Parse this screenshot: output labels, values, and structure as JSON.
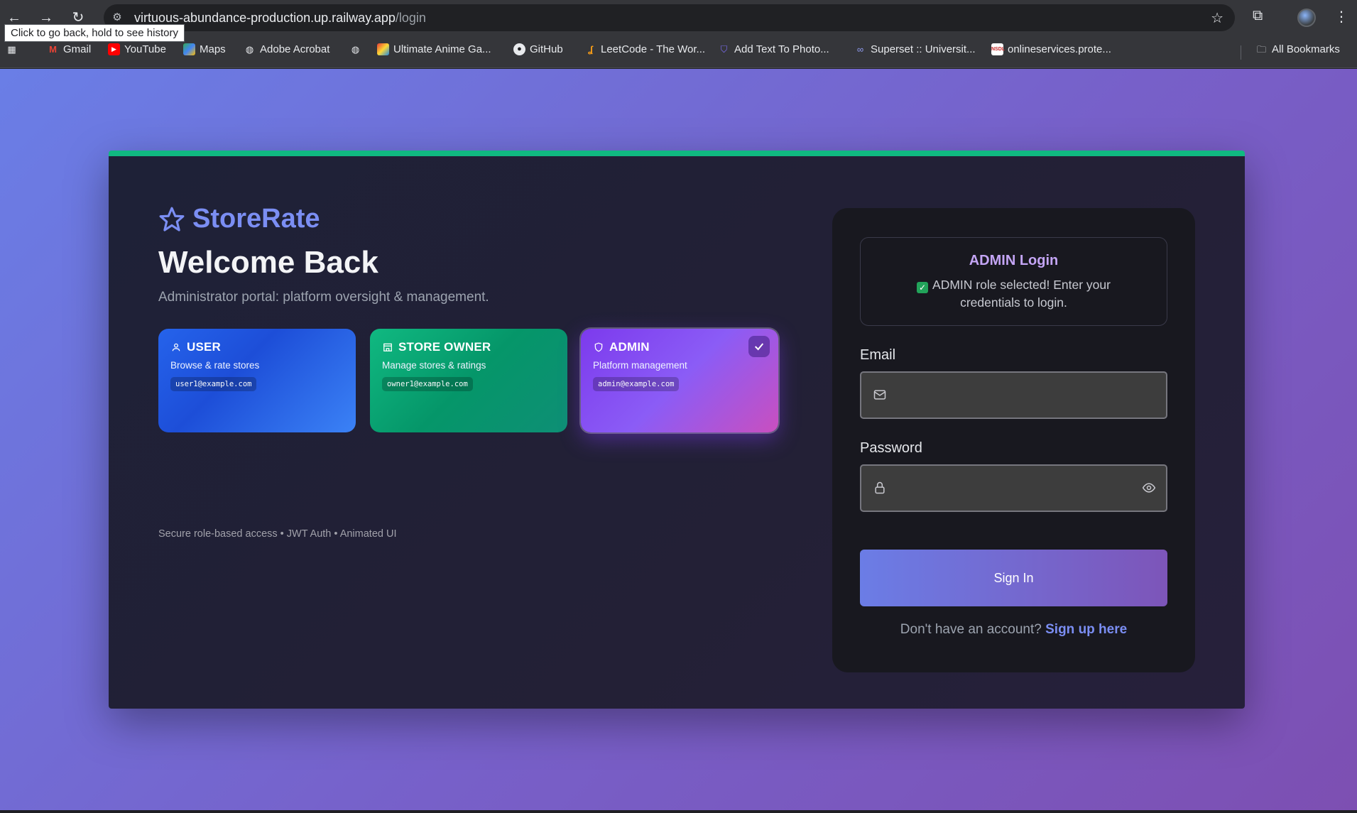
{
  "browser": {
    "url_host": "virtuous-abundance-production.up.railway.app",
    "url_path": "/login",
    "back_tooltip": "Click to go back, hold to see history",
    "bookmarks": [
      {
        "label": "Gmail",
        "icon": "gmail-icon"
      },
      {
        "label": "YouTube",
        "icon": "youtube-icon"
      },
      {
        "label": "Maps",
        "icon": "maps-icon"
      },
      {
        "label": "Adobe Acrobat",
        "icon": "globe-icon"
      },
      {
        "label": "",
        "icon": "globe-icon"
      },
      {
        "label": "Ultimate Anime Ga...",
        "icon": "anime-icon"
      },
      {
        "label": "GitHub",
        "icon": "github-icon"
      },
      {
        "label": "LeetCode - The Wor...",
        "icon": "leetcode-icon"
      },
      {
        "label": "Add Text To Photo...",
        "icon": "shield-icon"
      },
      {
        "label": "Superset :: Universit...",
        "icon": "superset-icon"
      },
      {
        "label": "onlineservices.prote...",
        "icon": "nsdl-icon"
      }
    ],
    "all_bookmarks": "All Bookmarks"
  },
  "brand": {
    "name": "StoreRate"
  },
  "hero": {
    "title": "Welcome Back",
    "subtitle": "Administrator portal: platform oversight & management."
  },
  "roles": [
    {
      "title": "USER",
      "desc": "Browse & rate stores",
      "email": "user1@example.com",
      "selected": false
    },
    {
      "title": "STORE OWNER",
      "desc": "Manage stores & ratings",
      "email": "owner1@example.com",
      "selected": false
    },
    {
      "title": "ADMIN",
      "desc": "Platform management",
      "email": "admin@example.com",
      "selected": true
    }
  ],
  "footnote": "Secure role-based access • JWT Auth • Animated UI",
  "login": {
    "title": "ADMIN Login",
    "message": "ADMIN role selected! Enter your credentials to login.",
    "email_label": "Email",
    "email_value": "",
    "password_label": "Password",
    "password_value": "",
    "submit": "Sign In",
    "signup_prompt": "Don't have an account?",
    "signup_link": "Sign up here"
  },
  "colors": {
    "accent": "#7b8ef3",
    "top_border": "#10b981",
    "admin_title": "#c4a5f5"
  }
}
